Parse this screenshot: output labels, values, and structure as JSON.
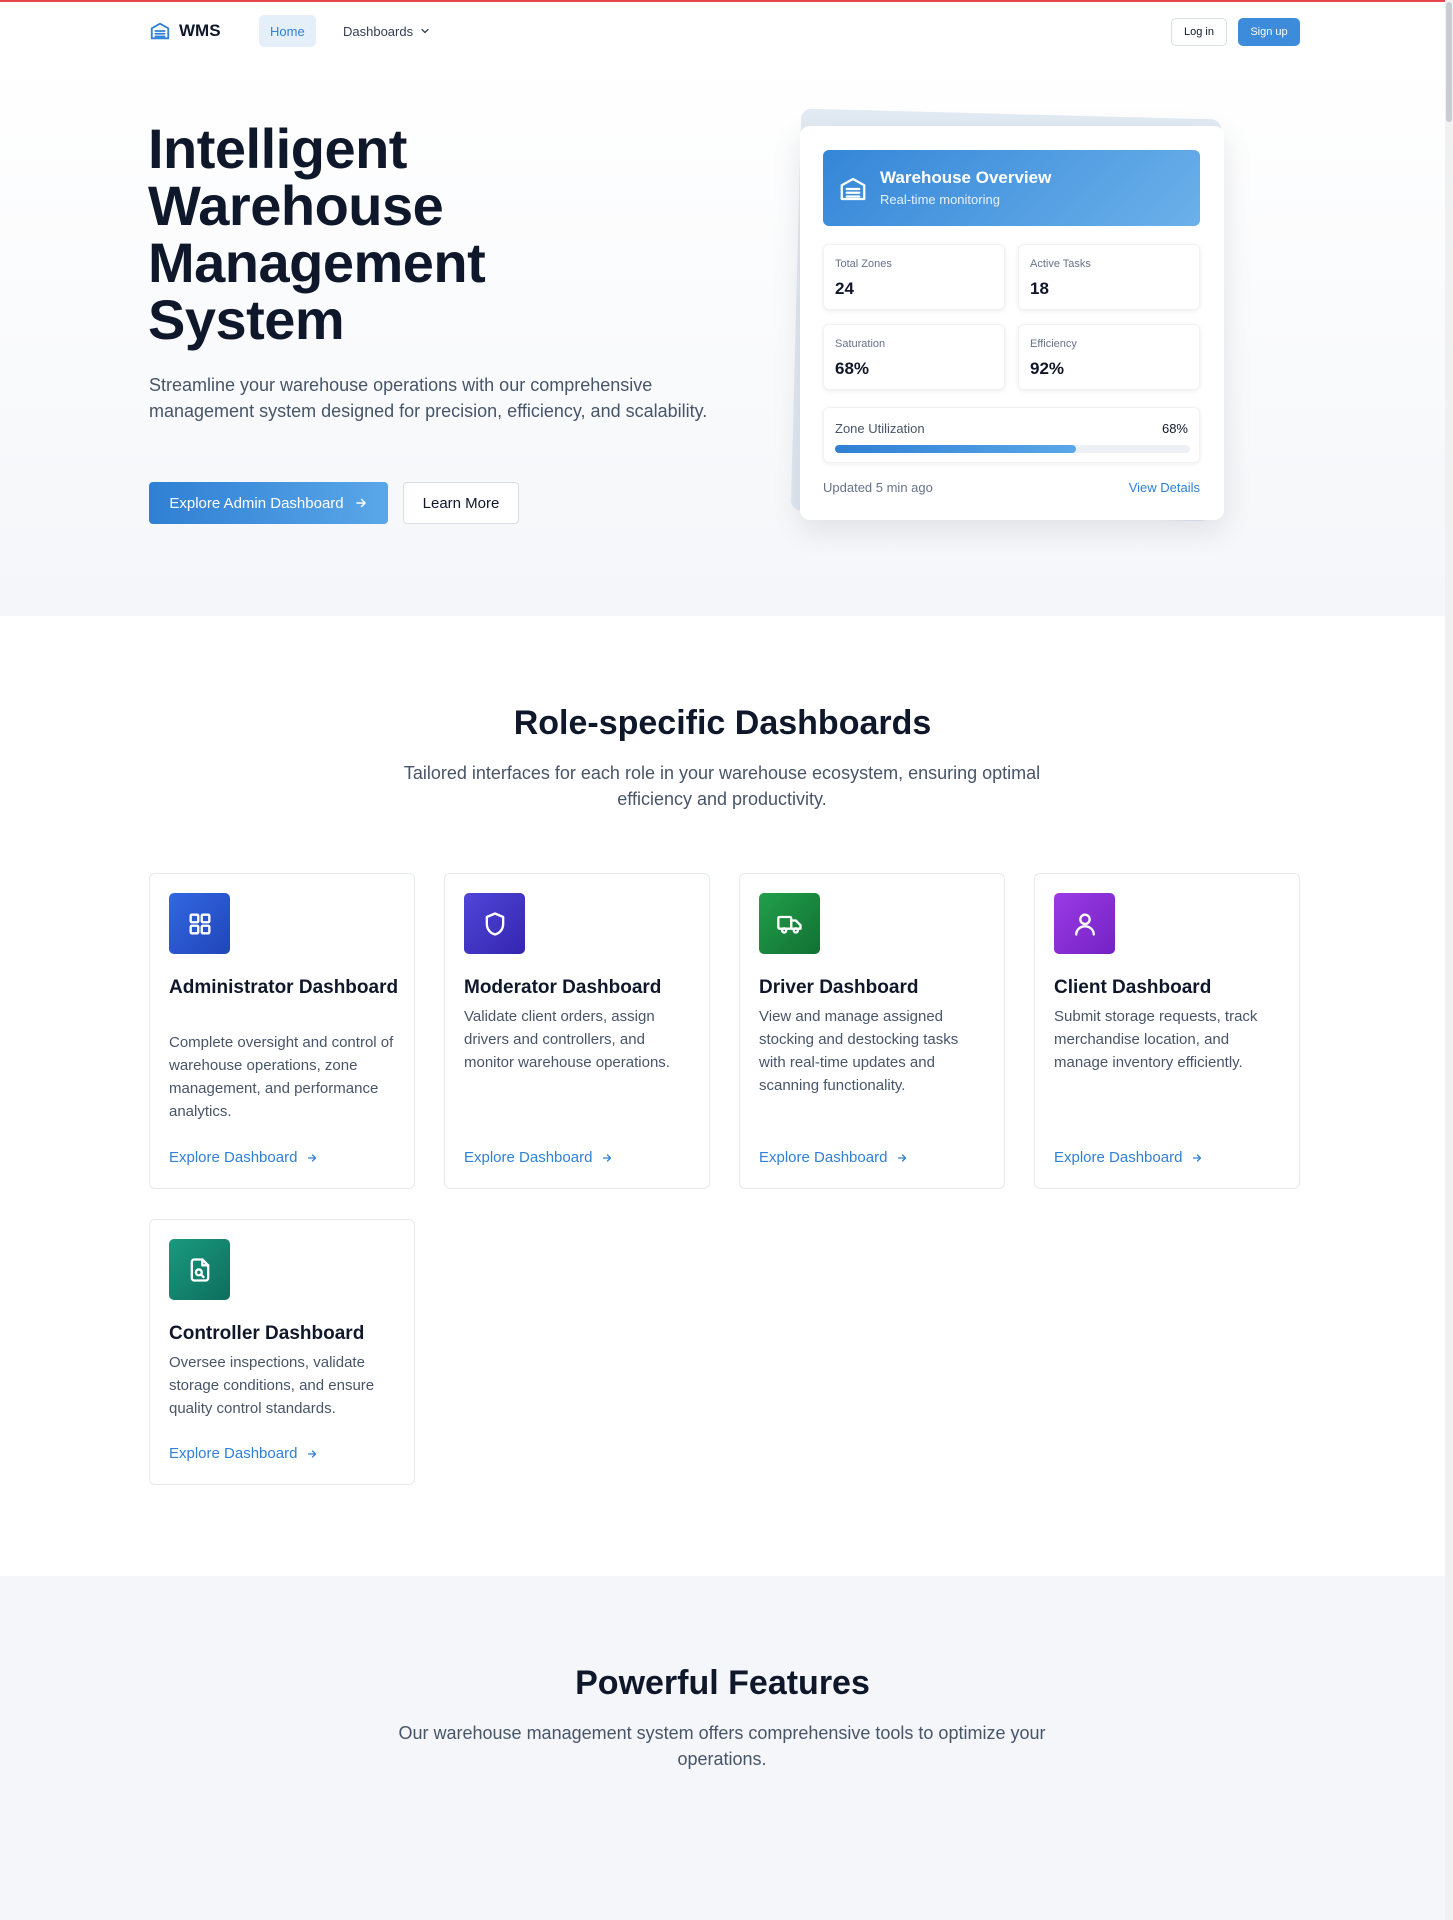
{
  "nav": {
    "brand": "WMS",
    "home": "Home",
    "dashboards": "Dashboards",
    "login": "Log in",
    "signup": "Sign up"
  },
  "hero": {
    "title": "Intelligent Warehouse Management System",
    "subtitle": "Streamline your warehouse operations with our comprehensive management system designed for precision, efficiency, and scalability.",
    "primary_button": "Explore Admin Dashboard",
    "secondary_button": "Learn More"
  },
  "overview": {
    "title": "Warehouse Overview",
    "subtitle": "Real-time monitoring",
    "stats": [
      {
        "label": "Total Zones",
        "value": "24"
      },
      {
        "label": "Active Tasks",
        "value": "18"
      },
      {
        "label": "Saturation",
        "value": "68%"
      },
      {
        "label": "Efficiency",
        "value": "92%"
      }
    ],
    "zone_label": "Zone Utilization",
    "zone_value": "68%",
    "zone_progress": 0.68,
    "updated": "Updated 5 min ago",
    "view_details": "View Details"
  },
  "roles": {
    "title": "Role-specific Dashboards",
    "subtitle": "Tailored interfaces for each role in your warehouse ecosystem, ensuring optimal efficiency and productivity.",
    "link_label": "Explore Dashboard",
    "cards": [
      {
        "title": "Administrator Dashboard",
        "description": "Complete oversight and control of warehouse operations, zone management, and performance analytics.",
        "icon": "grid-icon",
        "color": "#2d5ad6"
      },
      {
        "title": "Moderator Dashboard",
        "description": "Validate client orders, assign drivers and controllers, and monitor warehouse operations.",
        "icon": "shield-icon",
        "color": "#4336c9"
      },
      {
        "title": "Driver Dashboard",
        "description": "View and manage assigned stocking and destocking tasks with real-time updates and scanning functionality.",
        "icon": "truck-icon",
        "color": "#1a8a3e"
      },
      {
        "title": "Client Dashboard",
        "description": "Submit storage requests, track merchandise location, and manage inventory efficiently.",
        "icon": "user-icon",
        "color": "#8b2fd6"
      },
      {
        "title": "Controller Dashboard",
        "description": "Oversee inspections, validate storage conditions, and ensure quality control standards.",
        "icon": "file-search-icon",
        "color": "#0f8a72"
      }
    ]
  },
  "features": {
    "title": "Powerful Features",
    "subtitle": "Our warehouse management system offers comprehensive tools to optimize your operations."
  }
}
